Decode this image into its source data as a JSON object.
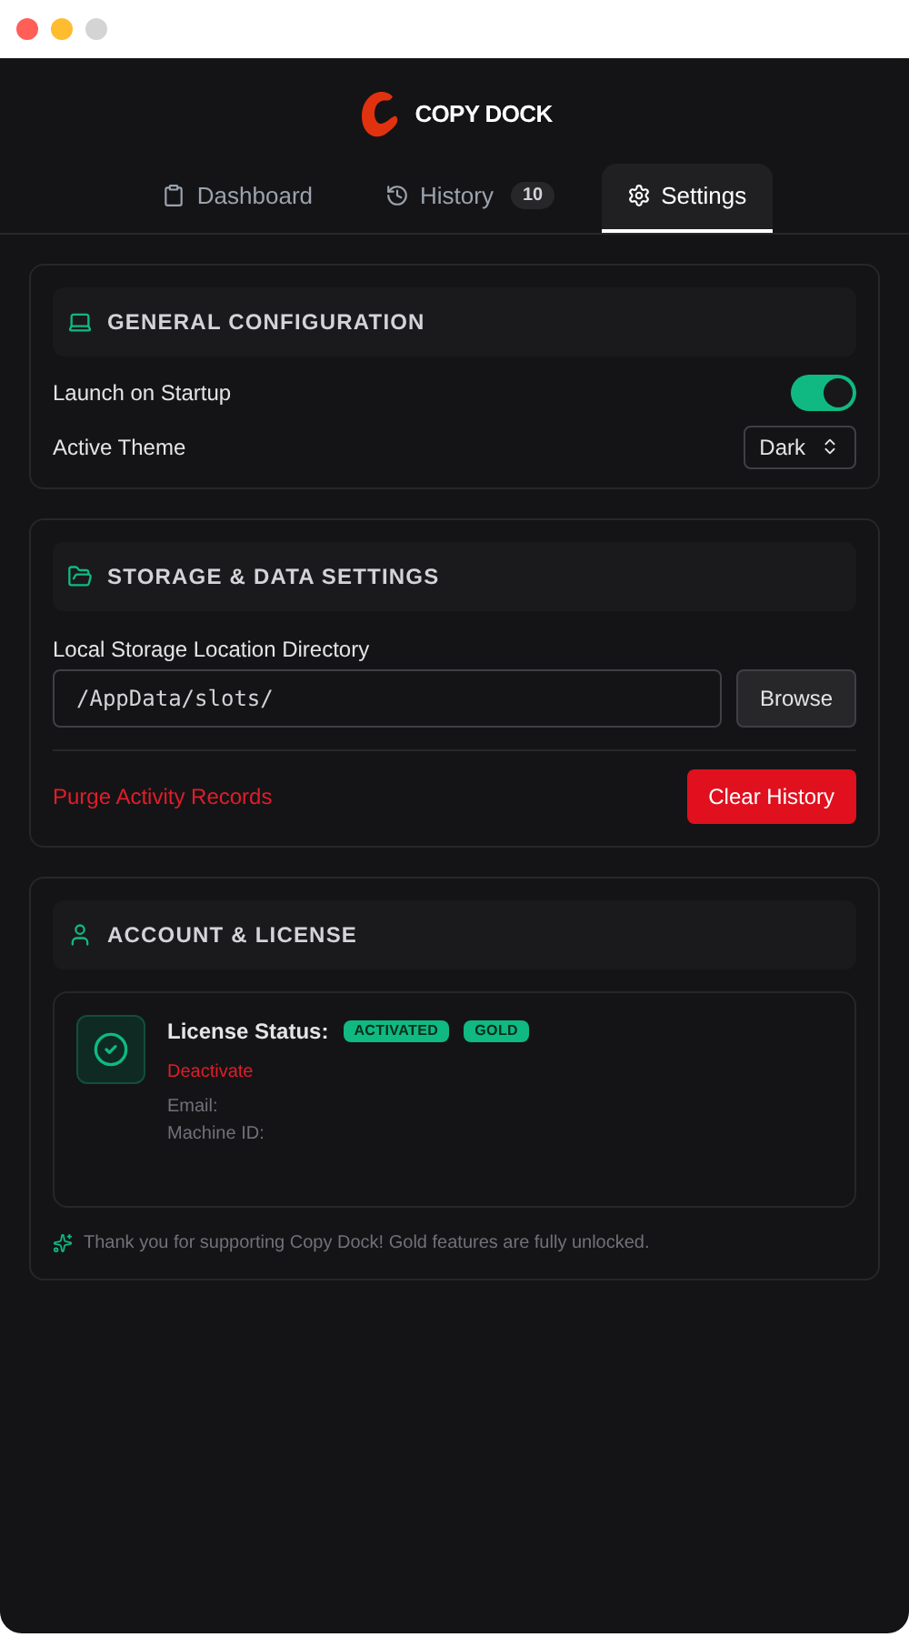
{
  "app": {
    "logo_text": "COPY DOCK"
  },
  "tabs": [
    {
      "label": "Dashboard",
      "selected": false
    },
    {
      "label": "History",
      "count": "10",
      "selected": false
    },
    {
      "label": "Settings",
      "selected": true
    }
  ],
  "general": {
    "title": "GENERAL CONFIGURATION",
    "launch_label": "Launch on Startup",
    "launch_on": true,
    "theme_label": "Active Theme",
    "theme_value": "Dark"
  },
  "storage": {
    "title": "STORAGE & DATA SETTINGS",
    "path_label": "Local Storage Location Directory",
    "path_value": "/AppData/slots/",
    "browse_button": "Browse",
    "purge_label": "Purge Activity Records",
    "clear_button": "Clear History"
  },
  "account": {
    "title": "ACCOUNT & LICENSE",
    "status_label": "License Status:",
    "badges": [
      "ACTIVATED",
      "GOLD"
    ],
    "deactivate_link": "Deactivate",
    "email_label": "Email:",
    "machine_label": "Machine ID:",
    "note": "Thank you for supporting Copy Dock! Gold features are fully unlocked."
  }
}
